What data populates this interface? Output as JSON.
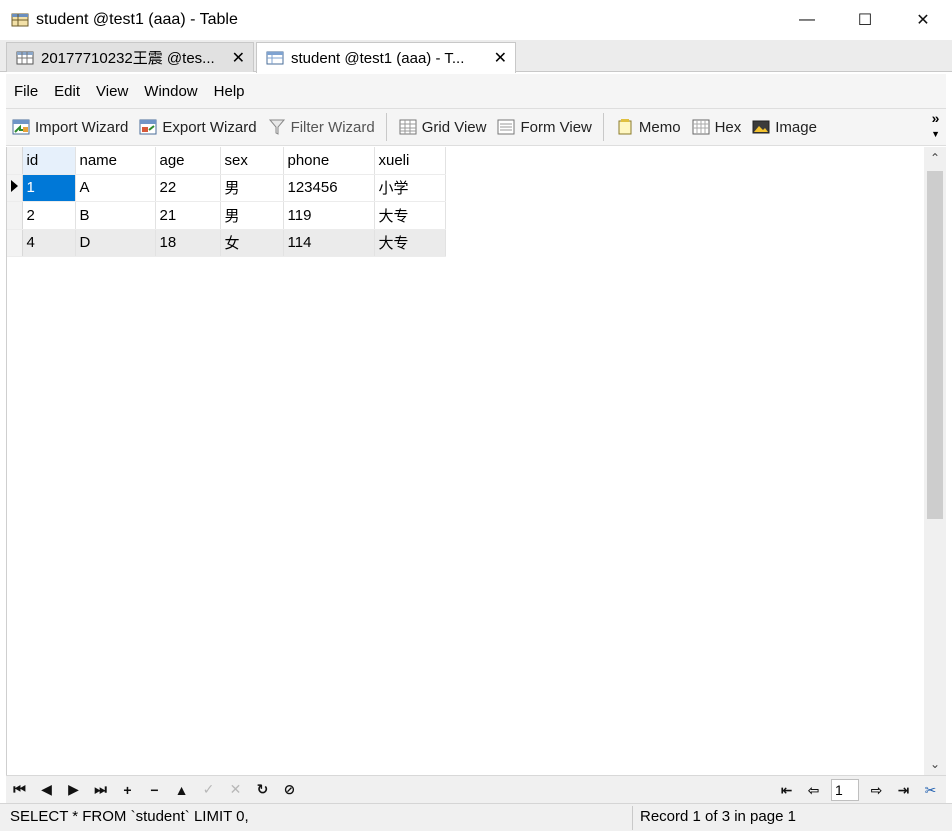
{
  "window": {
    "title": "student @test1 (aaa) - Table",
    "minimize": "—",
    "maximize": "☐",
    "close": "✕"
  },
  "tabs": [
    {
      "label": "20177710232王震 @tes...",
      "close": "✕",
      "active": false
    },
    {
      "label": "student @test1 (aaa) - T...",
      "close": "✕",
      "active": true
    }
  ],
  "menu": [
    "File",
    "Edit",
    "View",
    "Window",
    "Help"
  ],
  "toolbar": {
    "import_wizard": "Import Wizard",
    "export_wizard": "Export Wizard",
    "filter_wizard": "Filter Wizard",
    "grid_view": "Grid View",
    "form_view": "Form View",
    "memo": "Memo",
    "hex": "Hex",
    "image": "Image",
    "more": "»"
  },
  "grid": {
    "columns": [
      "id",
      "name",
      "age",
      "sex",
      "phone",
      "xueli"
    ],
    "rows": [
      {
        "id": "1",
        "name": "A",
        "age": "22",
        "sex": "男",
        "phone": "123456",
        "xueli": "小学"
      },
      {
        "id": "2",
        "name": "B",
        "age": "21",
        "sex": "男",
        "phone": "119",
        "xueli": "大专"
      },
      {
        "id": "4",
        "name": "D",
        "age": "18",
        "sex": "女",
        "phone": "114",
        "xueli": "大专"
      }
    ]
  },
  "navigator": {
    "first": "⏮",
    "prev": "◀",
    "next": "▶",
    "last": "⏭",
    "add": "+",
    "delete": "−",
    "apply": "▲",
    "cancel": "✓",
    "discard": "✕",
    "refresh": "↻",
    "stop": "⊘",
    "page_value": "1"
  },
  "status": {
    "sql": "SELECT * FROM `student` LIMIT 0,",
    "record": "Record 1 of 3 in page 1"
  },
  "colors": {
    "selection": "#0078d7",
    "header_selected": "#e6f0fb",
    "alt_row": "#ebebeb"
  }
}
